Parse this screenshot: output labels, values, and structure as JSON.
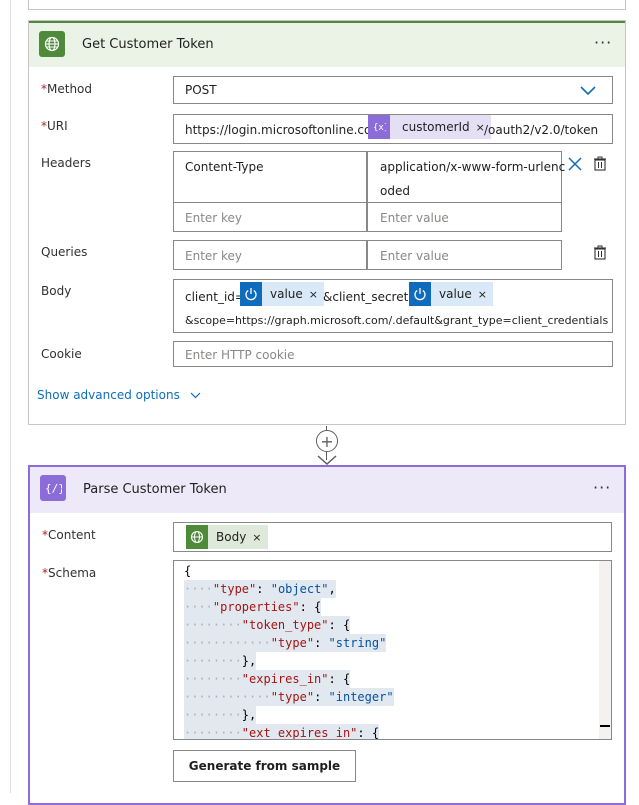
{
  "step1": {
    "title": "Get Customer Token",
    "more": "···",
    "fields": {
      "method_label": "Method",
      "method_value": "POST",
      "uri_label": "URI",
      "uri_prefix": "https://login.microsoftonline.com/",
      "uri_token": "customerId",
      "uri_suffix": "/oauth2/v2.0/token",
      "headers_label": "Headers",
      "header_key": "Content-Type",
      "header_value_line1": "application/x-www-form-urlenc",
      "header_value_line2": "oded",
      "key_placeholder": "Enter key",
      "value_placeholder": "Enter value",
      "queries_label": "Queries",
      "body_label": "Body",
      "body_part1": "client_id=",
      "body_token1": "value",
      "body_part2": "&client_secret=",
      "body_token2": "value",
      "body_line2": "&scope=https://graph.microsoft.com/.default&grant_type=client_credentials",
      "cookie_label": "Cookie",
      "cookie_placeholder": "Enter HTTP cookie",
      "advanced_link": "Show advanced options",
      "required_mark": "*",
      "remove_mark": "×"
    }
  },
  "connector": {
    "add_symbol": "+"
  },
  "step2": {
    "title": "Parse Customer Token",
    "more": "···",
    "content_label": "Content",
    "content_token": "Body",
    "schema_label": "Schema",
    "schema_lines": [
      "{",
      "    \"type\": \"object\",",
      "    \"properties\": {",
      "        \"token_type\": {",
      "            \"type\": \"string\"",
      "        },",
      "        \"expires_in\": {",
      "            \"type\": \"integer\"",
      "        },",
      "        \"ext_expires_in\": {"
    ],
    "generate_button": "Generate from sample"
  },
  "colors": {
    "http_accent": "#4e8a3a",
    "parse_accent": "#8c6cd9",
    "link": "#0f6cbd",
    "token_bg": "#d9e9f7"
  },
  "icons": [
    "globe-icon",
    "variable-icon",
    "power-icon",
    "chevron-down-icon",
    "delete-icon",
    "close-icon",
    "add-icon"
  ]
}
